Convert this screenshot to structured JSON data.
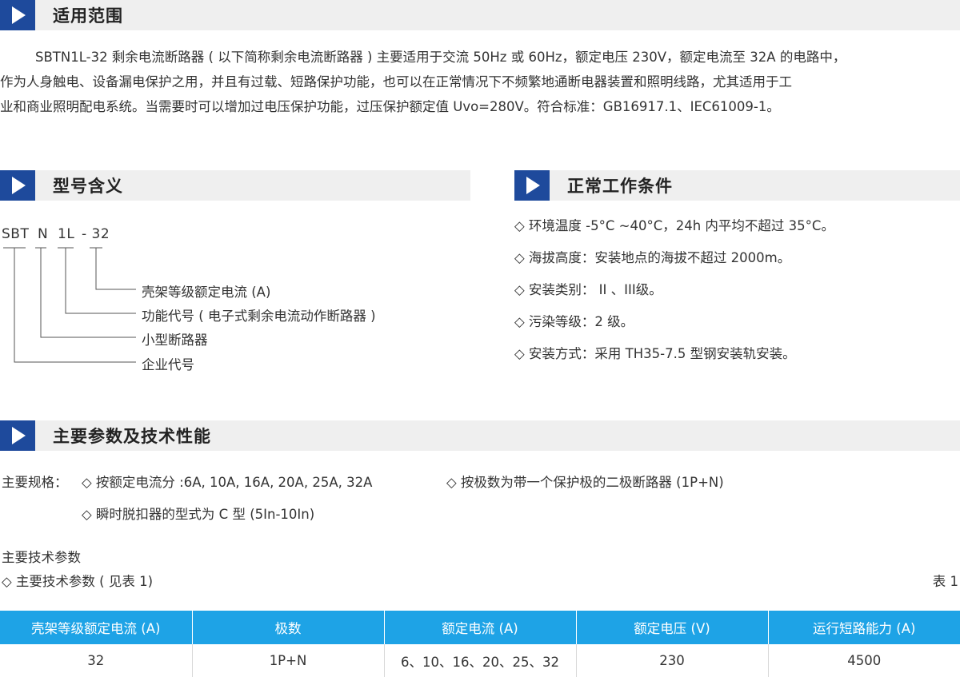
{
  "sections": {
    "scope": "适用范围",
    "model": "型号含义",
    "conditions": "正常工作条件",
    "params": "主要参数及技术性能"
  },
  "scope_text": {
    "line1": "SBTN1L-32 剩余电流断路器 ( 以下简称剩余电流断路器 ) 主要适用于交流 50Hz 或 60Hz，额定电压 230V，额定电流至 32A 的电路中，",
    "line2": "作为人身触电、设备漏电保护之用，并且有过载、短路保护功能，也可以在正常情况下不频繁地通断电器装置和照明线路，尤其适用于工",
    "line3": "业和商业照明配电系统。当需要时可以增加过电压保护功能，过压保护额定值 Uvo=280V。符合标准：GB16917.1、IEC61009-1。"
  },
  "model_code": {
    "part1": "SBT",
    "part2": "N",
    "part3": "1L",
    "part4": "- 32",
    "labels": [
      "壳架等级额定电流 (A)",
      "功能代号 ( 电子式剩余电流动作断路器 )",
      "小型断路器",
      "企业代号"
    ]
  },
  "conditions": [
    "◇ 环境温度 -5°C ~40°C，24h 内平均不超过 35°C。",
    "◇ 海拔高度：安装地点的海拔不超过 2000m。",
    "◇ 安装类别： II 、III级。",
    "◇ 污染等级：2 级。",
    "◇ 安装方式：采用 TH35-7.5 型钢安装轨安装。"
  ],
  "specs": {
    "label": "主要规格：",
    "item1": "◇ 按额定电流分 :6A, 10A, 16A, 20A, 25A, 32A",
    "item2": "◇ 按极数为带一个保护极的二极断路器 (1P+N)",
    "item3": "◇ 瞬时脱扣器的型式为 C 型 (5In-10In)",
    "tech_title": "主要技术参数",
    "tech_ref": "◇ 主要技术参数 ( 见表 1)",
    "table_label": "表 1"
  },
  "table": {
    "headers": [
      "壳架等级额定电流 (A)",
      "极数",
      "额定电流 (A)",
      "额定电压 (V)",
      "运行短路能力 (A)"
    ],
    "row": [
      "32",
      "1P+N",
      "6、10、16、20、25、32",
      "230",
      "4500"
    ]
  },
  "colors": {
    "section_icon_bg": "#1e4a9c",
    "section_bar_bg": "#efefef",
    "table_header_bg": "#1ea3e6"
  }
}
